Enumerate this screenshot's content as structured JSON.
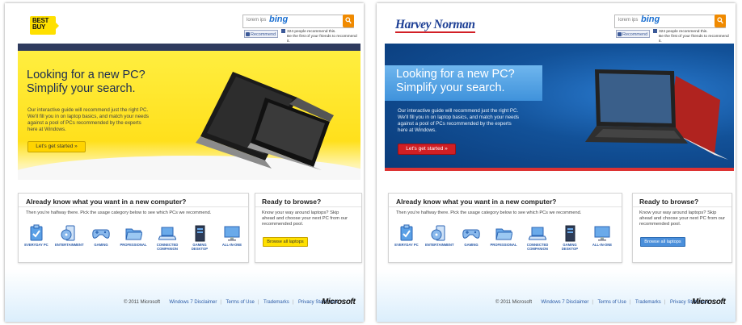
{
  "common": {
    "search_placeholder": "lorem ips",
    "search_brand": "bing",
    "recommend_label": "Recommend",
    "fb_line1": "324 people recommend this.",
    "fb_line2": "Be the first of your friends to recommend it.",
    "hero_title_line1": "Looking for a new PC?",
    "hero_title_line2": "Simplify your search.",
    "hero_desc": "Our interactive guide will recommend just the right PC. We'll fill you in on laptop basics, and match your needs against a pool of PCs recommended by the experts here at Windows.",
    "start_label": "Let's get started »",
    "section1_title": "Already know what you want in a new computer?",
    "section1_desc": "Then you're halfway there. Pick the usage category below to see which PCs we recommend.",
    "categories": [
      {
        "label": "EVERYDAY PC",
        "icon": "clipboard-check-icon"
      },
      {
        "label": "ENTERTAINMENT",
        "icon": "media-icon"
      },
      {
        "label": "GAMING",
        "icon": "gamepad-icon"
      },
      {
        "label": "PROFESSIONAL",
        "icon": "folder-icon"
      },
      {
        "label": "CONNECTED COMPANION",
        "icon": "laptop-icon"
      },
      {
        "label": "GAMING DESKTOP",
        "icon": "tower-icon"
      },
      {
        "label": "ALL-IN-ONE",
        "icon": "monitor-icon"
      }
    ],
    "section2_title": "Ready to browse?",
    "section2_desc": "Know your way around laptops? Skip ahead and choose your next PC from our recommended pool.",
    "browse_label": "Browse all laptops",
    "footer": {
      "copyright": "© 2011 Microsoft",
      "links": [
        "Windows 7 Disclaimer",
        "Terms of Use",
        "Trademarks",
        "Privacy Statement"
      ],
      "logo": "Microsoft"
    }
  },
  "left_brand": {
    "logo_text": "BEST BUY",
    "accent": "#ffe000"
  },
  "right_brand": {
    "logo_text": "Harvey Norman",
    "accent": "#d11f24"
  }
}
